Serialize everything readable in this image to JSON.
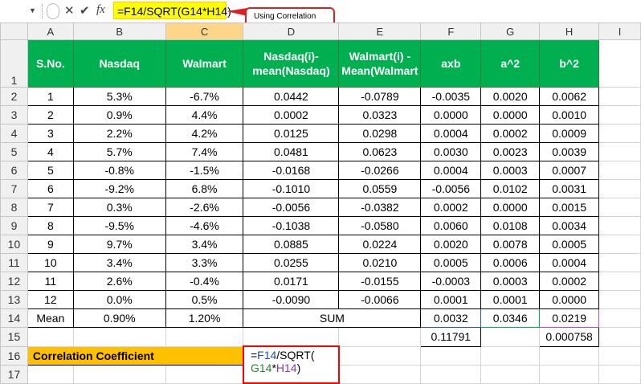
{
  "formula_bar": {
    "name_box_dropdown": "▼",
    "cancel_icon": "✕",
    "enter_icon": "✔",
    "fx_icon": "fx",
    "formula": "=F14/SQRT(G14*H14)"
  },
  "callout": {
    "text": "Using Correlation Coefficient Formula"
  },
  "columns": [
    "A",
    "B",
    "C",
    "D",
    "E",
    "F",
    "G",
    "H",
    "I"
  ],
  "header_row": [
    "S.No.",
    "Nasdaq",
    "Walmart",
    "Nasdaq(i)- mean(Nasdaq)",
    "Walmart(i) - Mean(Walmart",
    "axb",
    "a^2",
    "b^2"
  ],
  "rows": [
    [
      "1",
      "5.3%",
      "-6.7%",
      "0.0442",
      "-0.0789",
      "-0.0035",
      "0.0020",
      "0.0062"
    ],
    [
      "2",
      "0.9%",
      "4.4%",
      "0.0002",
      "0.0323",
      "0.0000",
      "0.0000",
      "0.0010"
    ],
    [
      "3",
      "2.2%",
      "4.2%",
      "0.0125",
      "0.0298",
      "0.0004",
      "0.0002",
      "0.0009"
    ],
    [
      "4",
      "5.7%",
      "7.4%",
      "0.0481",
      "0.0623",
      "0.0030",
      "0.0023",
      "0.0039"
    ],
    [
      "5",
      "-0.8%",
      "-1.5%",
      "-0.0168",
      "-0.0266",
      "0.0004",
      "0.0003",
      "0.0007"
    ],
    [
      "6",
      "-9.2%",
      "6.8%",
      "-0.1010",
      "0.0559",
      "-0.0056",
      "0.0102",
      "0.0031"
    ],
    [
      "7",
      "0.3%",
      "-2.6%",
      "-0.0056",
      "-0.0382",
      "0.0002",
      "0.0000",
      "0.0015"
    ],
    [
      "8",
      "-9.5%",
      "-4.6%",
      "-0.1038",
      "-0.0580",
      "0.0060",
      "0.0108",
      "0.0034"
    ],
    [
      "9",
      "9.7%",
      "3.4%",
      "0.0885",
      "0.0224",
      "0.0020",
      "0.0078",
      "0.0005"
    ],
    [
      "10",
      "3.4%",
      "3.3%",
      "0.0255",
      "0.0210",
      "0.0005",
      "0.0006",
      "0.0004"
    ],
    [
      "11",
      "2.6%",
      "-0.4%",
      "0.0171",
      "-0.0155",
      "-0.0003",
      "0.0003",
      "0.0002"
    ],
    [
      "12",
      "0.0%",
      "0.5%",
      "-0.0090",
      "-0.0066",
      "0.0001",
      "0.0001",
      "0.0000"
    ]
  ],
  "mean_row": {
    "label": "Mean",
    "nasdaq": "0.90%",
    "walmart": "1.20%",
    "sum_label": "SUM",
    "f": "0.0032",
    "g": "0.0346",
    "h": "0.0219"
  },
  "row15": {
    "f": "0.11791",
    "h": "0.000758"
  },
  "correlation": {
    "label": "Correlation Coefficient",
    "eq": "=",
    "f14": "F14",
    "sqrt": "/SQRT(",
    "g14": "G14",
    "star": "*",
    "h14": "H14",
    "close": ")"
  },
  "row_numbers": [
    "1",
    "2",
    "3",
    "4",
    "5",
    "6",
    "7",
    "8",
    "9",
    "10",
    "11",
    "12",
    "13",
    "14",
    "15",
    "16",
    "17"
  ],
  "colors": {
    "header_green": "#00b050",
    "label_gold": "#ffc000",
    "formula_yellow": "#ffff00",
    "edit_border": "#ff0000"
  }
}
